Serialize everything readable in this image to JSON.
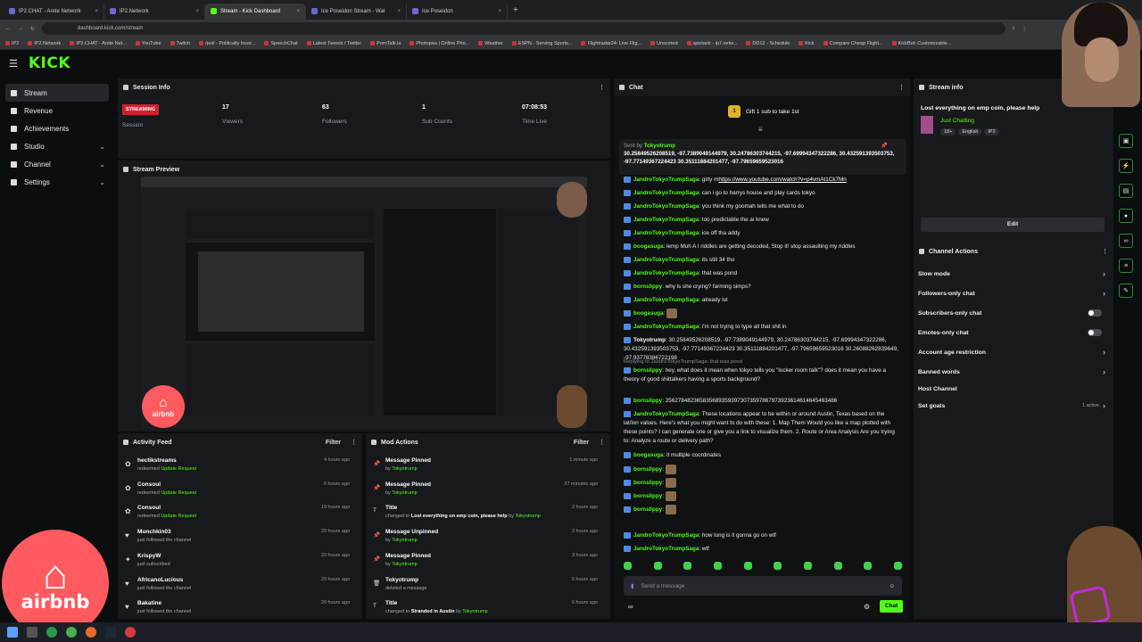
{
  "browser": {
    "tabs": [
      {
        "label": "IP2.CHAT - Arete Network",
        "active": false
      },
      {
        "label": "IP2.Network",
        "active": false
      },
      {
        "label": "Stream - Kick Dashboard",
        "active": true
      },
      {
        "label": "Ice Poseidon Stream - Wat",
        "active": false
      },
      {
        "label": "Ice Poseidon",
        "active": false
      }
    ],
    "url": "dashboard.kick.com/stream",
    "bookmarks": [
      "IP2",
      "IP2.Network",
      "IP2.CHAT - Arete Net...",
      "YouTube",
      "Twitch",
      "/pol/ - Politically Incor...",
      "SpeechChat",
      "Latest Tweets / Twitter",
      "PornTalk.la",
      "Photopea | Online Pho...",
      "Weather",
      "ESPN - Serving Sports...",
      "Flightradar24: Live Flig...",
      "Unscored",
      "spictank - ip7.netw...",
      "DD12 - Schedule",
      "Kick",
      "Compare Cheap Flight...",
      "KickBot: Customizable..."
    ]
  },
  "app": {
    "logo": "KICK"
  },
  "sidebar": {
    "items": [
      {
        "label": "Stream",
        "active": true,
        "chevron": false
      },
      {
        "label": "Revenue",
        "active": false,
        "chevron": false
      },
      {
        "label": "Achievements",
        "active": false,
        "chevron": false
      },
      {
        "label": "Studio",
        "active": false,
        "chevron": true
      },
      {
        "label": "Channel",
        "active": false,
        "chevron": true
      },
      {
        "label": "Settings",
        "active": false,
        "chevron": true
      }
    ]
  },
  "session": {
    "title": "Session Info",
    "status": "STREAMING",
    "status_label": "Session",
    "viewers": "17",
    "viewers_label": "Viewers",
    "followers": "63",
    "followers_label": "Followers",
    "subs": "1",
    "subs_label": "Sub Counts",
    "time": "07:08:53",
    "time_label": "Time Live"
  },
  "preview": {
    "title": "Stream Preview"
  },
  "activity": {
    "title": "Activity Feed",
    "filter": "Filter",
    "rows": [
      {
        "name": "hectikstreams",
        "action": "redeemed",
        "reward": "Update Request",
        "time": "4 hours ago",
        "icon": "reward-icon"
      },
      {
        "name": "Consoul",
        "action": "redeemed",
        "reward": "Update Request",
        "time": "6 hours ago",
        "icon": "reward-icon"
      },
      {
        "name": "Consoul",
        "action": "redeemed",
        "reward": "Update Request",
        "time": "19 hours ago",
        "icon": "reward-icon"
      },
      {
        "name": "Munchkin03",
        "action": "just followed the channel",
        "reward": "",
        "time": "20 hours ago",
        "icon": "heart-icon"
      },
      {
        "name": "KrispyW",
        "action": "just subscribed",
        "reward": "",
        "time": "20 hours ago",
        "icon": "star-icon"
      },
      {
        "name": "AfricanoLucious",
        "action": "just followed the channel",
        "reward": "",
        "time": "20 hours ago",
        "icon": "heart-icon"
      },
      {
        "name": "Bakatine",
        "action": "just followed the channel",
        "reward": "",
        "time": "20 hours ago",
        "icon": "heart-icon"
      }
    ]
  },
  "mod": {
    "title": "Mod Actions",
    "filter": "Filter",
    "rows": [
      {
        "name": "Message Pinned",
        "pre": "by",
        "detail": "",
        "user": "Tokyotrump",
        "time": "1 minute ago"
      },
      {
        "name": "Message Pinned",
        "pre": "by",
        "detail": "",
        "user": "Tokyotrump",
        "time": "27 minutes ago"
      },
      {
        "name": "Title",
        "pre": "changed to",
        "detail": "Lost everything on emp coin, please help",
        "user": "Tokyotrump",
        "time": "2 hours ago"
      },
      {
        "name": "Message Unpinned",
        "pre": "by",
        "detail": "",
        "user": "Tokyotrump",
        "time": "2 hours ago"
      },
      {
        "name": "Message Pinned",
        "pre": "by",
        "detail": "",
        "user": "Tokyotrump",
        "time": "3 hours ago"
      },
      {
        "name": "Tokyotrump",
        "pre": "deleted a message",
        "detail": "",
        "user": "",
        "time": "5 hours ago"
      },
      {
        "name": "Title",
        "pre": "changed to",
        "detail": "Stranded in Austin",
        "user": "Tokyotrump",
        "time": "6 hours ago"
      }
    ]
  },
  "chat": {
    "title": "Chat",
    "gift": "Gift 1 sub to take 1st",
    "pinned_by": "Sent by",
    "pinned_user": "Tokyotrump",
    "pinned_text": "30.25849526208519, -97.7389049144979, 30.24786303744215, -97.69994347322286, 30.432591393503753, -97.77149367224423 30.35111884201477, -97.79659659523016",
    "messages": [
      {
        "user": "JandroTokyoTrumpSaga",
        "text": "girly m",
        "link": "https://www.youtube.com/watch?v=p4vmAt1Ck7Mn"
      },
      {
        "user": "JandroTokyoTrumpSaga",
        "text": "can i go to harrys house and play cards tokyo"
      },
      {
        "user": "JandroTokyoTrumpSaga",
        "text": "you think my goomah tells me what to do"
      },
      {
        "user": "JandroTokyoTrumpSaga",
        "text": "too predictable the ai knew"
      },
      {
        "user": "JandroTokyoTrumpSaga",
        "text": "ice off tha addy"
      },
      {
        "user": "boogasuga",
        "text": "lemp Muh A I riddles are getting decoded, Stop it! stop assaulting my riddles"
      },
      {
        "user": "JandroTokyoTrumpSaga",
        "text": "its still 34 tho"
      },
      {
        "user": "JandroTokyoTrumpSaga",
        "text": "that was pond"
      },
      {
        "user": "bornslippy",
        "text": "why is she crying? farming simps?"
      },
      {
        "user": "JandroTokyoTrumpSaga",
        "text": "already lol"
      },
      {
        "user": "boogasuga",
        "text": "",
        "emote": true
      },
      {
        "user": "JandroTokyoTrumpSaga",
        "text": "i'm not trying to type all that shit in"
      },
      {
        "user": "Tokyotrump",
        "text": "30.25849526208519, -97.7389049144979, 30.24786303744215, -97.69994347322286, 30.432591393503753, -97.77149367224423 30.35111884201477, -97.79659659523016 30.26088262839649, -97.93778386722198"
      },
      {
        "reply": "Replying to JandroTokyoTrumpSaga: that was pond",
        "user": "bornslippy",
        "text": "hey, what does it mean when tokyo tells you \"locker room talk\"? does it mean you have a theory of good shittalkers having a sports background?"
      },
      {
        "user": "bornslippy",
        "text": "2562784823658356893593973073597867973923614614645463486"
      },
      {
        "user": "JandroTokyoTrumpSaga",
        "text": "These locations appear to be within or around Austin, Texas based on the lat/lon values. Here's what you might want to do with these: 1. Map Them Would you like a map plotted with these points? I can generate one or give you a link to visualize them. 2. Route or Area Analysis Are you trying to: Analyze a route or delivery path?"
      },
      {
        "user": "boogasuga",
        "text": "it multiple coordinates"
      },
      {
        "user": "bornslippy",
        "text": "",
        "emote": true
      },
      {
        "user": "bornslippy",
        "text": "",
        "emote": true
      },
      {
        "user": "bornslippy",
        "text": "",
        "emote": true
      },
      {
        "user": "bornslippy",
        "text": "",
        "emote": true
      },
      {
        "user": "JandroTokyoTrumpSaga",
        "text": "how long is it gonna go on wtf"
      },
      {
        "user": "JandroTokyoTrumpSaga",
        "text": "wtf"
      }
    ],
    "input_placeholder": "Send a message",
    "send_label": "Chat",
    "points": "∞"
  },
  "streaminfo": {
    "title": "Stream info",
    "stream_title": "Lost everything on emp coin, please help",
    "category": "Just Chatting",
    "tags": [
      "18+",
      "English",
      "IP2"
    ],
    "edit_label": "Edit"
  },
  "channel_actions": {
    "title": "Channel Actions",
    "items": [
      {
        "label": "Slow mode",
        "kind": "arrow"
      },
      {
        "label": "Followers-only chat",
        "kind": "arrow"
      },
      {
        "label": "Subscribers-only chat",
        "kind": "toggle"
      },
      {
        "label": "Emotes-only chat",
        "kind": "toggle"
      },
      {
        "label": "Account age restriction",
        "kind": "arrow"
      },
      {
        "label": "Banned words",
        "kind": "arrow"
      },
      {
        "label": "Host Channel",
        "kind": "none"
      },
      {
        "label": "Set goals",
        "kind": "arrow",
        "badge": "1 active"
      }
    ]
  },
  "overlay": {
    "airbnb": "airbnb"
  },
  "colors": {
    "brand": "#53fc18",
    "live": "#d0222e",
    "airbnb": "#ff5a5f"
  }
}
